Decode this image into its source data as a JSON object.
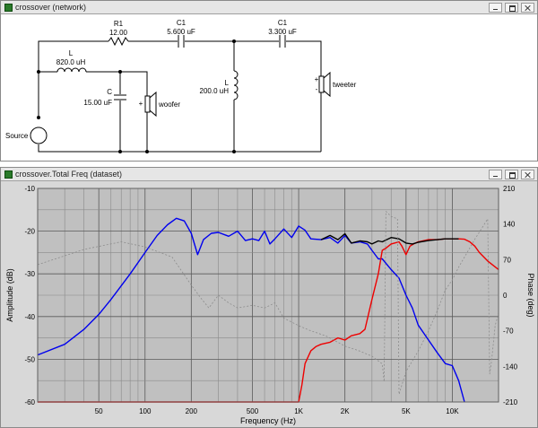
{
  "top_window": {
    "title": "crossover (network)",
    "labels": {
      "r1_name": "R1",
      "r1_value": "12.00",
      "c1a_name": "C1",
      "c1a_value": "5.600 uF",
      "c1b_name": "C1",
      "c1b_value": "3.300 uF",
      "l1_name": "L",
      "l1_value": "820.0 uH",
      "c2_name": "C",
      "c2_value": "15.00 uF",
      "l2_name": "L",
      "l2_value": "200.0 uH",
      "woofer": "woofer",
      "tweeter": "tweeter",
      "source": "Source"
    }
  },
  "bottom_window": {
    "title": "crossover.Total Freq (dataset)"
  },
  "chart_data": {
    "type": "line",
    "xlabel": "Frequency (Hz)",
    "ylabel": "Amplitude (dB)",
    "y2label": "Phase (deg)",
    "xscale": "log",
    "xlim": [
      20,
      20000
    ],
    "ylim": [
      -60,
      -10
    ],
    "y2lim": [
      -210,
      210
    ],
    "grid": true,
    "x_ticks": [
      {
        "v": 50,
        "label": "50"
      },
      {
        "v": 100,
        "label": "100"
      },
      {
        "v": 200,
        "label": "200"
      },
      {
        "v": 500,
        "label": "500"
      },
      {
        "v": 1000,
        "label": "1K"
      },
      {
        "v": 2000,
        "label": "2K"
      },
      {
        "v": 5000,
        "label": "5K"
      },
      {
        "v": 10000,
        "label": "10K"
      }
    ],
    "y_ticks": [
      {
        "v": -10,
        "label": "-10"
      },
      {
        "v": -20,
        "label": "-20"
      },
      {
        "v": -30,
        "label": "-30"
      },
      {
        "v": -40,
        "label": "-40"
      },
      {
        "v": -50,
        "label": "-50"
      },
      {
        "v": -60,
        "label": "-60"
      }
    ],
    "y2_ticks": [
      {
        "v": 210,
        "label": "210"
      },
      {
        "v": 140,
        "label": "140"
      },
      {
        "v": 70,
        "label": "70"
      },
      {
        "v": 0,
        "label": "0"
      },
      {
        "v": -70,
        "label": "-70"
      },
      {
        "v": -140,
        "label": "-140"
      },
      {
        "v": -210,
        "label": "-210"
      }
    ],
    "series": [
      {
        "axis": "y",
        "color": "#0000ee",
        "dash": false,
        "x": [
          20,
          30,
          40,
          50,
          60,
          80,
          100,
          120,
          140,
          160,
          180,
          200,
          220,
          240,
          270,
          300,
          350,
          400,
          450,
          500,
          550,
          600,
          650,
          700,
          800,
          900,
          1000,
          1100,
          1200,
          1400,
          1600,
          1800,
          2000,
          2200,
          2500,
          2800,
          3000,
          3300,
          3500,
          4000,
          4500,
          5000,
          5500,
          6000,
          7000,
          8000,
          9000,
          10000,
          11000,
          12000
        ],
        "y": [
          -49,
          -46.5,
          -43,
          -39.5,
          -36,
          -30,
          -25,
          -21,
          -18.5,
          -17,
          -17.6,
          -20.5,
          -25.5,
          -22,
          -20.5,
          -20.3,
          -21.2,
          -20,
          -22.2,
          -21.8,
          -22.2,
          -20,
          -23,
          -21.8,
          -19.5,
          -21.5,
          -18.8,
          -19.8,
          -21.8,
          -22,
          -21.5,
          -22.8,
          -21,
          -22.8,
          -22.5,
          -23,
          -24.5,
          -26.5,
          -26.5,
          -29,
          -31,
          -35,
          -38,
          -42,
          -45.5,
          -48.5,
          -51,
          -51.5,
          -55,
          -60
        ]
      },
      {
        "axis": "y",
        "color": "#ee0000",
        "dash": false,
        "x": [
          20,
          500,
          1000,
          1050,
          1100,
          1200,
          1300,
          1400,
          1600,
          1800,
          2000,
          2200,
          2500,
          2700,
          3000,
          3300,
          3500,
          3700,
          4000,
          4200,
          4500,
          4700,
          5000,
          5300,
          5600,
          6000,
          7000,
          8000,
          9000,
          10000,
          11000,
          12000,
          13000,
          14000,
          15000,
          17000,
          20000
        ],
        "y": [
          -60,
          -60,
          -60,
          -56,
          -51,
          -48,
          -47,
          -46.5,
          -46,
          -45,
          -45.5,
          -44.5,
          -44,
          -43,
          -36,
          -30,
          -24.5,
          -24,
          -23,
          -22.8,
          -22.5,
          -23.5,
          -25.5,
          -23.5,
          -23,
          -22.5,
          -22,
          -22,
          -21.8,
          -21.8,
          -21.8,
          -21.9,
          -22.5,
          -23.5,
          -25,
          -27,
          -29
        ]
      },
      {
        "axis": "y",
        "color": "#000000",
        "dash": false,
        "x": [
          1400,
          1600,
          1800,
          2000,
          2200,
          2500,
          2800,
          3000,
          3300,
          3500,
          4000,
          4500,
          5000,
          5500,
          6000,
          7000,
          8000,
          9000,
          10000,
          11000
        ],
        "y": [
          -22,
          -21,
          -22,
          -20.6,
          -22.8,
          -22.3,
          -22.5,
          -23,
          -22.3,
          -22.5,
          -21.5,
          -21.8,
          -22.8,
          -23,
          -22.6,
          -22.2,
          -22,
          -21.8,
          -21.8,
          -21.8
        ]
      },
      {
        "axis": "y2",
        "color": "#8c8c8c",
        "dash": true,
        "x": [
          20,
          40,
          70,
          100,
          150,
          200,
          230,
          260,
          300,
          350,
          400,
          500,
          600,
          650,
          700,
          800,
          1000,
          1200,
          1500,
          2000,
          2500,
          3000,
          3500,
          3600,
          3700,
          4000,
          4400,
          4500,
          5000,
          6000,
          7000,
          8000,
          9000,
          10000,
          11000,
          14000,
          17000,
          17500,
          18000,
          19000,
          20000
        ],
        "y": [
          60,
          90,
          105,
          95,
          75,
          20,
          -5,
          -25,
          0,
          -15,
          -25,
          -20,
          -25,
          -20,
          -15,
          -45,
          -60,
          -70,
          -80,
          -100,
          -110,
          -120,
          -135,
          -170,
          165,
          155,
          150,
          -195,
          -150,
          -110,
          -70,
          -30,
          10,
          30,
          55,
          110,
          150,
          -155,
          -130,
          -60,
          -35
        ]
      }
    ]
  }
}
